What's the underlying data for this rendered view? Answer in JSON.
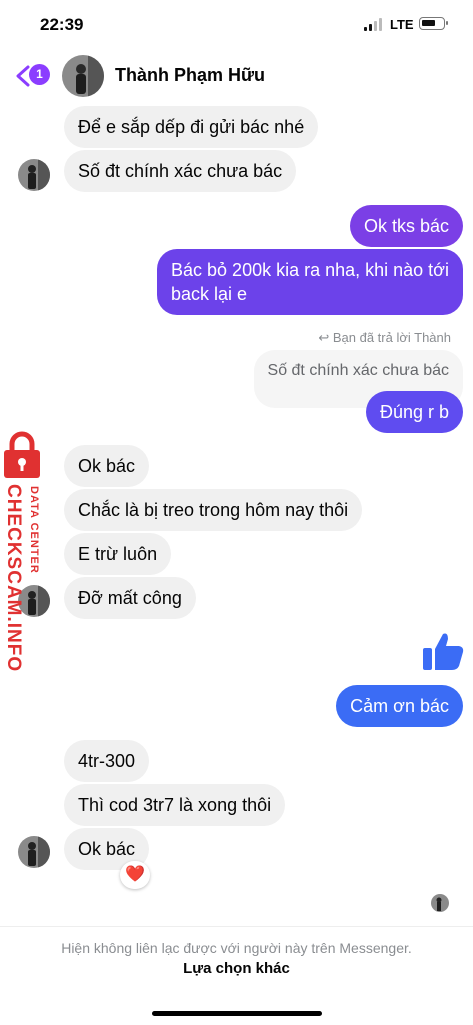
{
  "status_bar": {
    "time": "22:39",
    "network": "LTE"
  },
  "header": {
    "back_badge": "1",
    "contact_name": "Thành Phạm Hữu"
  },
  "messages": [
    {
      "text": "Để e sắp dếp đi gửi bác nhé"
    },
    {
      "text": "Số đt chính xác chưa bác"
    },
    {
      "text": "Ok tks bác"
    },
    {
      "text_line1": "Bác bỏ 200k kia ra nha, khi nào tới",
      "text_line2": "back lại e"
    },
    {
      "reply_note": "Bạn đã trả lời Thành"
    },
    {
      "text": "Số đt chính xác chưa bác"
    },
    {
      "text": "Đúng r b"
    },
    {
      "text": "Ok bác"
    },
    {
      "text": "Chắc là bị treo trong hôm nay thôi"
    },
    {
      "text": "E trừ luôn"
    },
    {
      "text": "Đỡ mất công"
    },
    {
      "text": "Cảm ơn bác"
    },
    {
      "text": "4tr-300"
    },
    {
      "text": "Thì cod 3tr7 là xong thôi"
    },
    {
      "text": "Ok bác"
    }
  ],
  "watermark": {
    "line1": "DATA CENTER",
    "line2": "CHECKSCAM.INFO"
  },
  "reaction": "❤️",
  "footer": {
    "notice": "Hiện không liên lạc được với người này trên Messenger.",
    "action": "Lựa chọn khác"
  },
  "colors": {
    "accent_purple": "#7b3fe6",
    "accent_blue": "#3b6cf5",
    "watermark_red": "#e03131"
  }
}
